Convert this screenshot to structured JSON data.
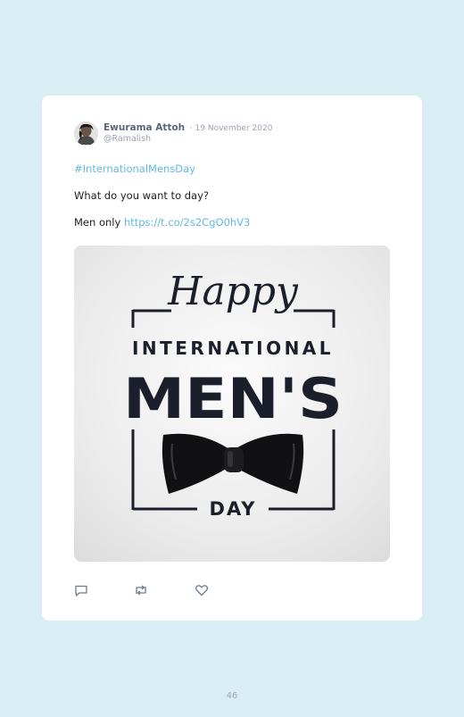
{
  "tweet": {
    "author_name": "Ewurama Attoh",
    "date": "· 19 November 2020",
    "handle": "@Ramalish",
    "hashtag": "#InternationalMensDay",
    "line1": "What do you want to day?",
    "line2_text": "Men only ",
    "line2_link": "https://t.co/2s2CgO0hV3",
    "image": {
      "script_word": "Happy",
      "line_international": "INTERNATIONAL",
      "line_mens": "MEN'S",
      "line_day": "DAY"
    },
    "actions": {
      "reply_icon": "reply-icon",
      "retweet_icon": "retweet-icon",
      "like_icon": "heart-icon"
    }
  },
  "page": {
    "number": "46"
  },
  "colors": {
    "background": "#d9eef4",
    "card": "#ffffff",
    "link": "#5fb9e6",
    "dark_text": "#1b1e2b"
  }
}
